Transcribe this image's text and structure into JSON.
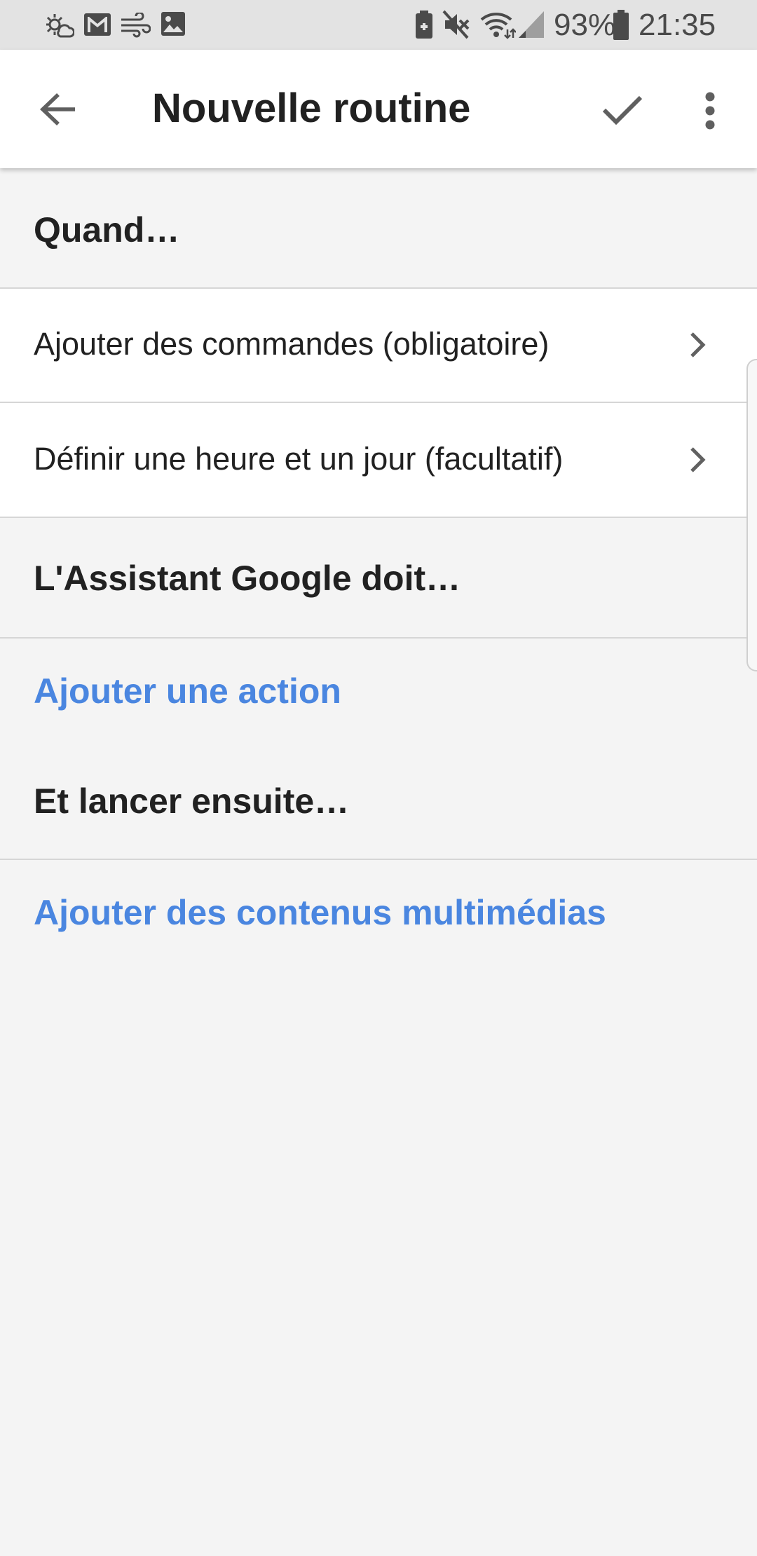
{
  "status_bar": {
    "icons": [
      "weather-icon",
      "gmail-icon",
      "wind-icon",
      "gallery-icon",
      "battery-saver-icon",
      "mute-icon",
      "wifi-icon",
      "signal-icon",
      "battery-icon"
    ],
    "battery_percent": "93%",
    "time": "21:35"
  },
  "app_bar": {
    "title": "Nouvelle routine",
    "icons": [
      "back-arrow-icon",
      "check-icon",
      "more-vert-icon"
    ]
  },
  "when_section": {
    "header": "Quand…",
    "items": [
      {
        "label": "Ajouter des commandes (obligatoire)",
        "icon": "chevron-right-icon"
      },
      {
        "label": "Définir une heure et un jour (facultatif)",
        "icon": "chevron-right-icon"
      }
    ]
  },
  "assistant_section": {
    "header": "L'Assistant Google doit…",
    "add_action_label": "Ajouter une action"
  },
  "then_section": {
    "header": "Et lancer ensuite…",
    "add_media_label": "Ajouter des contenus multimédias"
  },
  "colors": {
    "accent": "#4a86e0",
    "background": "#f4f4f4",
    "surface": "#ffffff",
    "text_primary": "#212121"
  }
}
